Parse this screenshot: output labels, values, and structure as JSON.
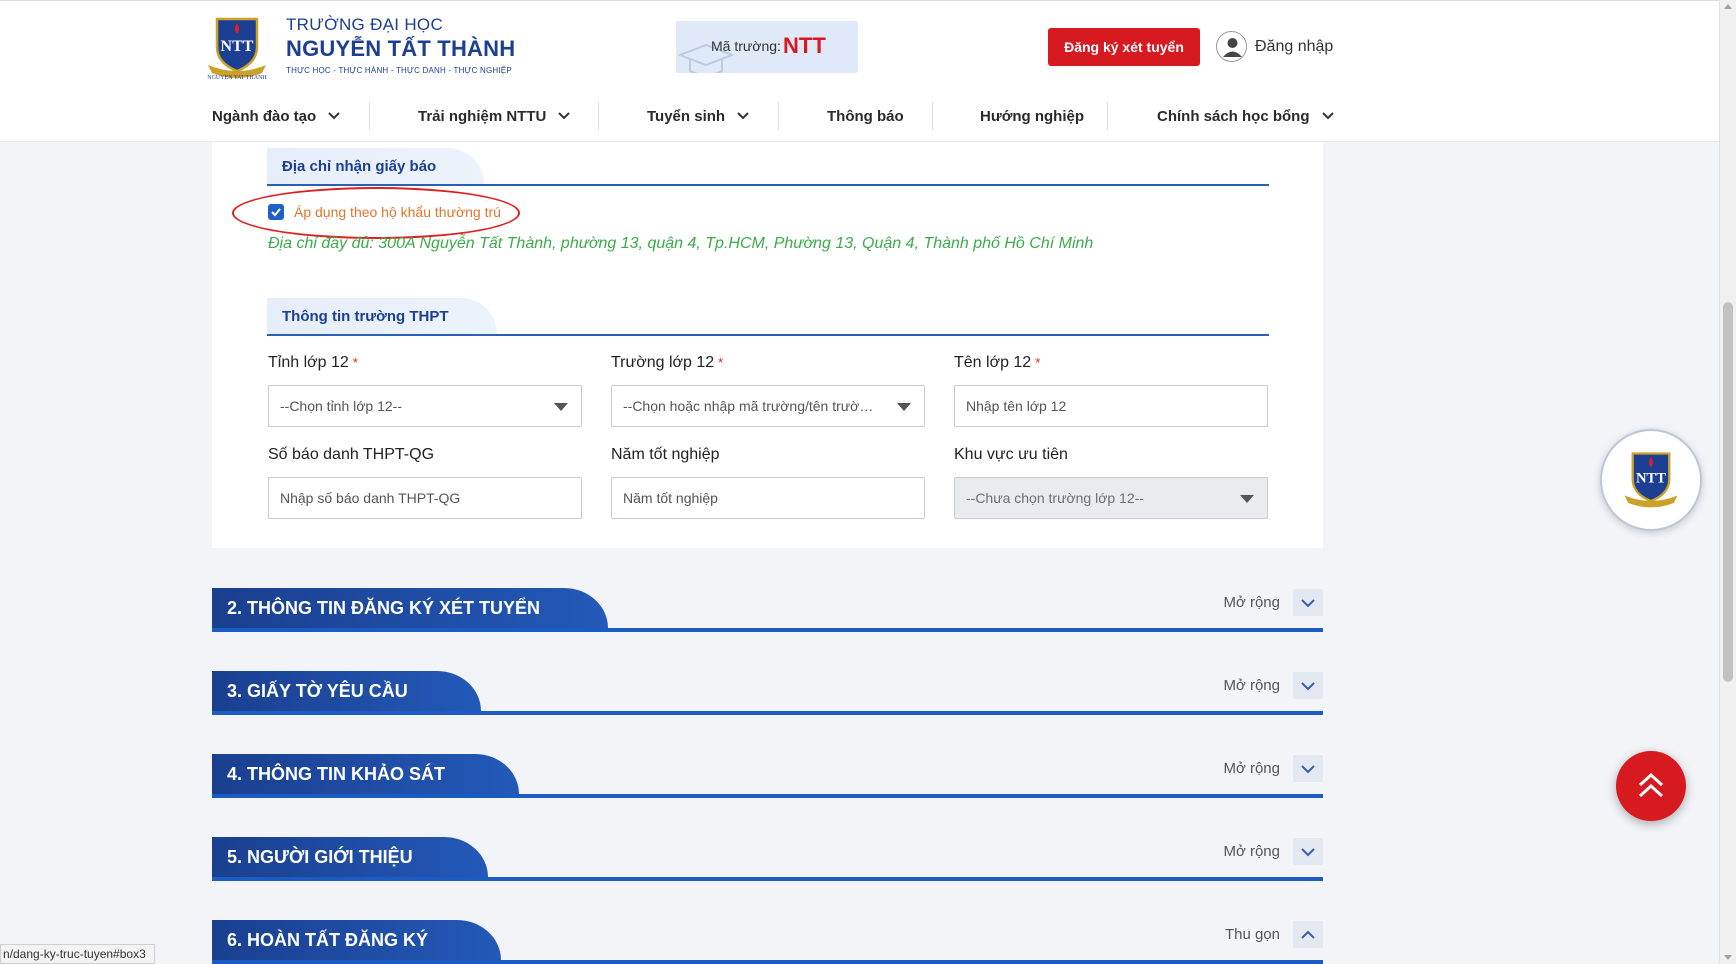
{
  "header": {
    "logo": {
      "line1": "TRƯỜNG ĐẠI HỌC",
      "line2": "NGUYỄN TẤT THÀNH",
      "slogan": "THỰC HỌC - THỰC HÀNH - THỰC DANH - THỰC NGHIỆP",
      "emblem_caption": "NGUYEN TAT THANH"
    },
    "school_code_label": "Mã trường:",
    "school_code": "NTT",
    "register_button": "Đăng ký xét tuyển",
    "login_label": "Đăng nhập"
  },
  "nav": {
    "items": [
      {
        "label": "Ngành đào tạo",
        "dropdown": true
      },
      {
        "label": "Trải nghiệm NTTU",
        "dropdown": true
      },
      {
        "label": "Tuyển sinh",
        "dropdown": true
      },
      {
        "label": "Thông báo",
        "dropdown": false
      },
      {
        "label": "Hướng nghiệp",
        "dropdown": false
      },
      {
        "label": "Chính sách học bổng",
        "dropdown": true
      }
    ]
  },
  "address": {
    "heading": "Địa chỉ nhận giấy báo",
    "checkbox_label": "Áp dụng theo hộ khẩu thường trú",
    "checkbox_checked": true,
    "full_address": "Địa chỉ đầy đủ: 300A Nguyễn Tất Thành, phường 13, quận 4, Tp.HCM, Phường 13, Quận 4, Thành phố Hồ Chí Minh"
  },
  "school": {
    "heading": "Thông tin trường THPT",
    "fields": {
      "province": {
        "label": "Tỉnh lớp 12",
        "required_mark": "*",
        "placeholder": "--Chọn tỉnh lớp 12--"
      },
      "school": {
        "label": "Trường lớp 12",
        "required_mark": "*",
        "placeholder": "--Chọn hoặc nhập mã trường/tên trường--"
      },
      "class": {
        "label": "Tên lớp 12",
        "required_mark": "*",
        "placeholder": "Nhập tên lớp 12"
      },
      "candidate_no": {
        "label": "Số báo danh THPT-QG",
        "placeholder": "Nhập số báo danh THPT-QG"
      },
      "grad_year": {
        "label": "Năm tốt nghiệp",
        "placeholder": "Năm tốt nghiệp"
      },
      "priority_area": {
        "label": "Khu vực ưu tiên",
        "placeholder": "--Chưa chọn trường lớp 12--"
      }
    }
  },
  "sections": [
    {
      "title": "2. THÔNG TIN ĐĂNG KÝ XÉT TUYỂN",
      "toggle_label": "Mở rộng",
      "state": "collapsed"
    },
    {
      "title": "3. GIẤY TỜ YÊU CẦU",
      "toggle_label": "Mở rộng",
      "state": "collapsed"
    },
    {
      "title": "4. THÔNG TIN KHẢO SÁT",
      "toggle_label": "Mở rộng",
      "state": "collapsed"
    },
    {
      "title": "5. NGƯỜI GIỚI THIỆU",
      "toggle_label": "Mở rộng",
      "state": "collapsed"
    },
    {
      "title": "6. HOÀN TẤT ĐĂNG KÝ",
      "toggle_label": "Thu gọn",
      "state": "expanded"
    }
  ],
  "status_bar_url": "n/dang-ky-truc-tuyen#box3",
  "colors": {
    "brand_blue": "#1c3f94",
    "brand_red": "#d71920",
    "address_green": "#3cab4a",
    "checkbox_label_orange": "#e0752d"
  }
}
